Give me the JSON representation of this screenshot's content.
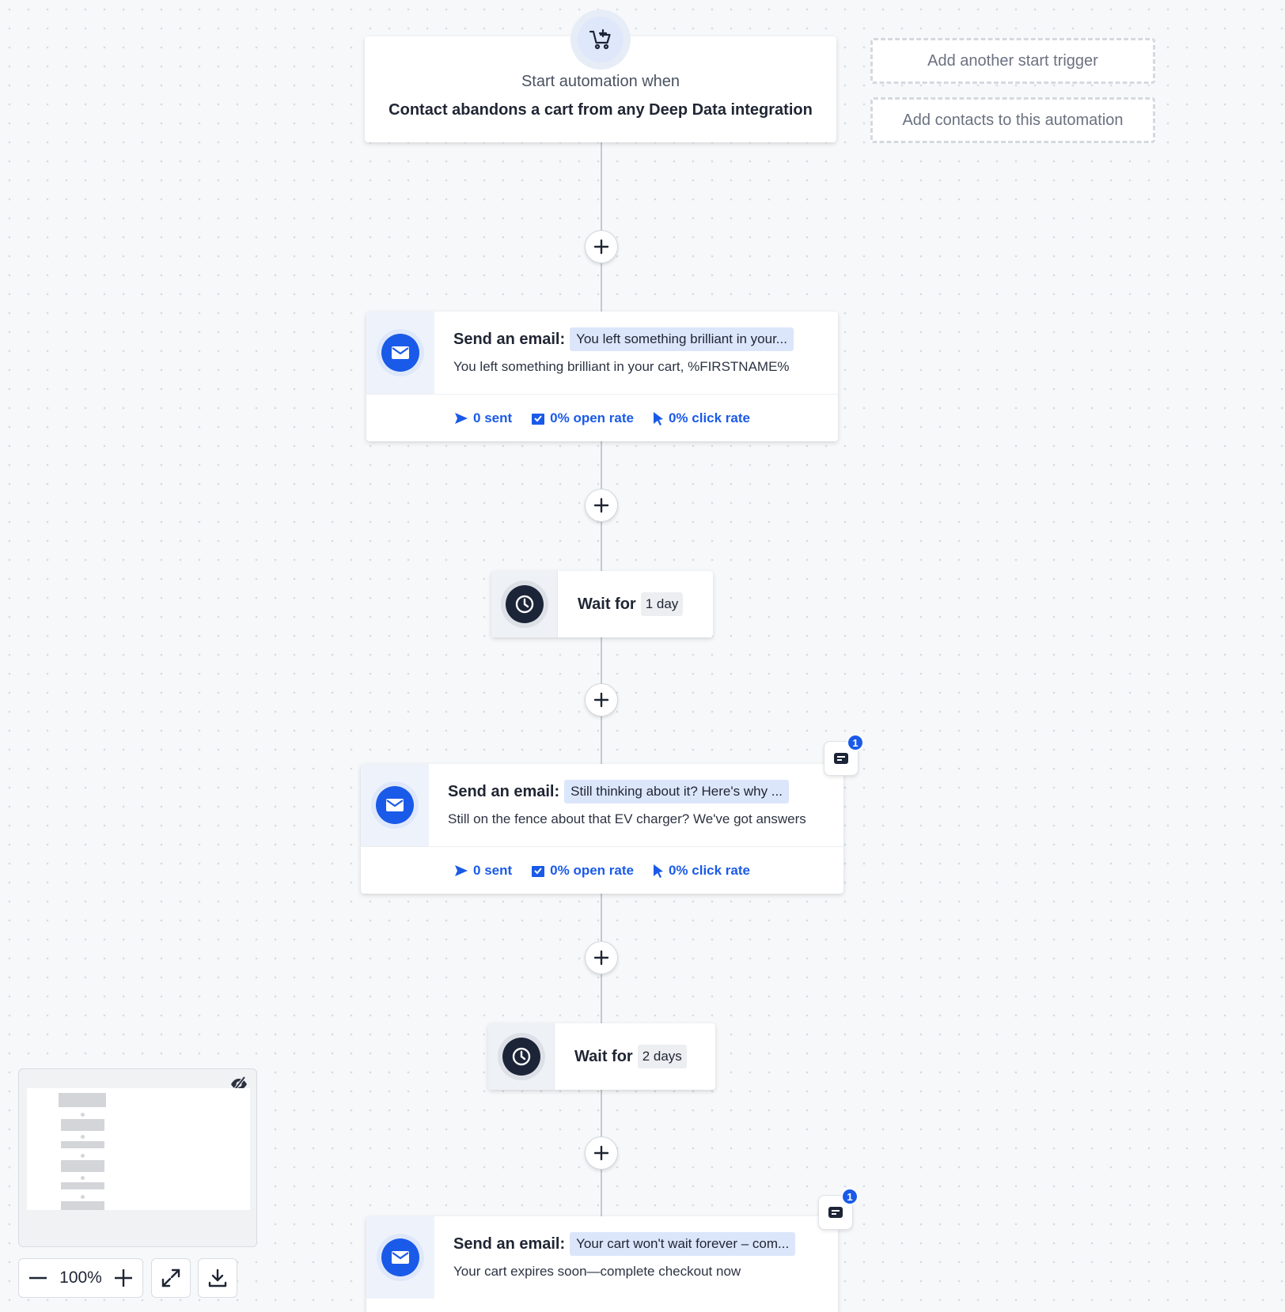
{
  "trigger": {
    "subtitle": "Start automation when",
    "title": "Contact abandons a cart from any Deep Data integration",
    "icon": "cart-plus-icon"
  },
  "side_actions": {
    "add_trigger": "Add another start trigger",
    "add_contacts": "Add contacts to this automation"
  },
  "steps": [
    {
      "type": "email",
      "label": "Send an email:",
      "subject_pill": "You left something brilliant in your...",
      "description": "You left something brilliant in your cart, %FIRSTNAME%",
      "stats": {
        "sent": "0 sent",
        "open_rate": "0% open rate",
        "click_rate": "0% click rate"
      }
    },
    {
      "type": "wait",
      "label": "Wait for",
      "duration": "1 day"
    },
    {
      "type": "email",
      "label": "Send an email:",
      "subject_pill": "Still thinking about it? Here's why ...",
      "description": "Still on the fence about that EV charger? We've got answers",
      "stats": {
        "sent": "0 sent",
        "open_rate": "0% open rate",
        "click_rate": "0% click rate"
      },
      "note_count": "1"
    },
    {
      "type": "wait",
      "label": "Wait for",
      "duration": "2 days"
    },
    {
      "type": "email",
      "label": "Send an email:",
      "subject_pill": "Your cart won't wait forever – com...",
      "description": "Your cart expires soon—complete checkout now",
      "note_count": "1"
    }
  ],
  "zoom": {
    "value": "100%"
  },
  "colors": {
    "accent": "#1a5ae8",
    "pill": "#dce6fb",
    "canvas": "#f6f8fa",
    "dark": "#1c2437"
  }
}
